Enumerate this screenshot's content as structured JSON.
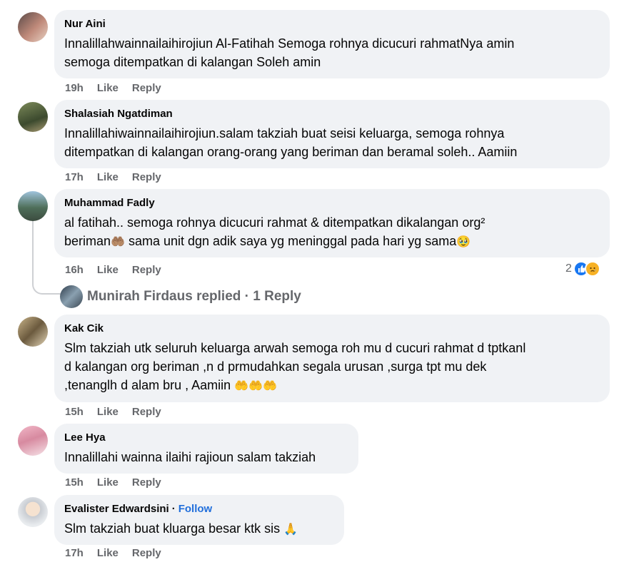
{
  "comments": [
    {
      "author": "Nur Aini",
      "text": "Innalillahwainnailaihirojiun Al-Fatihah Semoga rohnya dicucuri rahmatNya amin\nsemoga ditempatkan di kalangan Soleh amin",
      "time": "19h",
      "like": "Like",
      "reply": "Reply"
    },
    {
      "author": "Shalasiah Ngatdiman",
      "text": "Innalillahiwainnailaihirojiun.salam takziah buat seisi keluarga, semoga rohnya\nditempatkan di kalangan orang-orang yang beriman dan beramal soleh.. Aamiin",
      "time": "17h",
      "like": "Like",
      "reply": "Reply"
    },
    {
      "author": "Muhammad Fadly",
      "text_line1": "al fatihah.. semoga rohnya dicucuri rahmat & ditempatkan dikalangan org²",
      "text_line2_a": "beriman",
      "emoji_hands": "🤲🏽",
      "text_line2_b": " sama unit dgn adik saya yg meninggal pada hari yg sama",
      "emoji_tear": "🥹",
      "time": "16h",
      "like": "Like",
      "reply": "Reply",
      "reaction_count": "2",
      "reply_summary": "Munirah Firdaus replied · 1 Reply"
    },
    {
      "author": "Kak Cik",
      "text_line1": "Slm takziah utk seluruh keluarga arwah semoga roh mu d cucuri rahmat d tptkanl",
      "text_line2": "d kalangan org beriman ,n d prmudahkan segala urusan ,surga tpt mu dek",
      "text_line3": ",tenanglh d alam bru , Aamiin ",
      "emoji_hands": "🤲🤲🤲",
      "time": "15h",
      "like": "Like",
      "reply": "Reply"
    },
    {
      "author": "Lee Hya",
      "text": "Innalillahi wainna ilaihi rajioun salam takziah",
      "time": "15h",
      "like": "Like",
      "reply": "Reply"
    },
    {
      "author": "Evalister Edwardsini",
      "follow": "Follow",
      "text": "Slm takziah buat kluarga besar ktk sis ",
      "emoji_pray": "🙏",
      "time": "17h",
      "like": "Like",
      "reply": "Reply"
    }
  ],
  "colors": {
    "bubble": "#f0f2f5",
    "meta": "#65676b",
    "follow": "#216fdb",
    "like_reaction": "#1877f2",
    "sad_reaction": "#f7b125"
  }
}
